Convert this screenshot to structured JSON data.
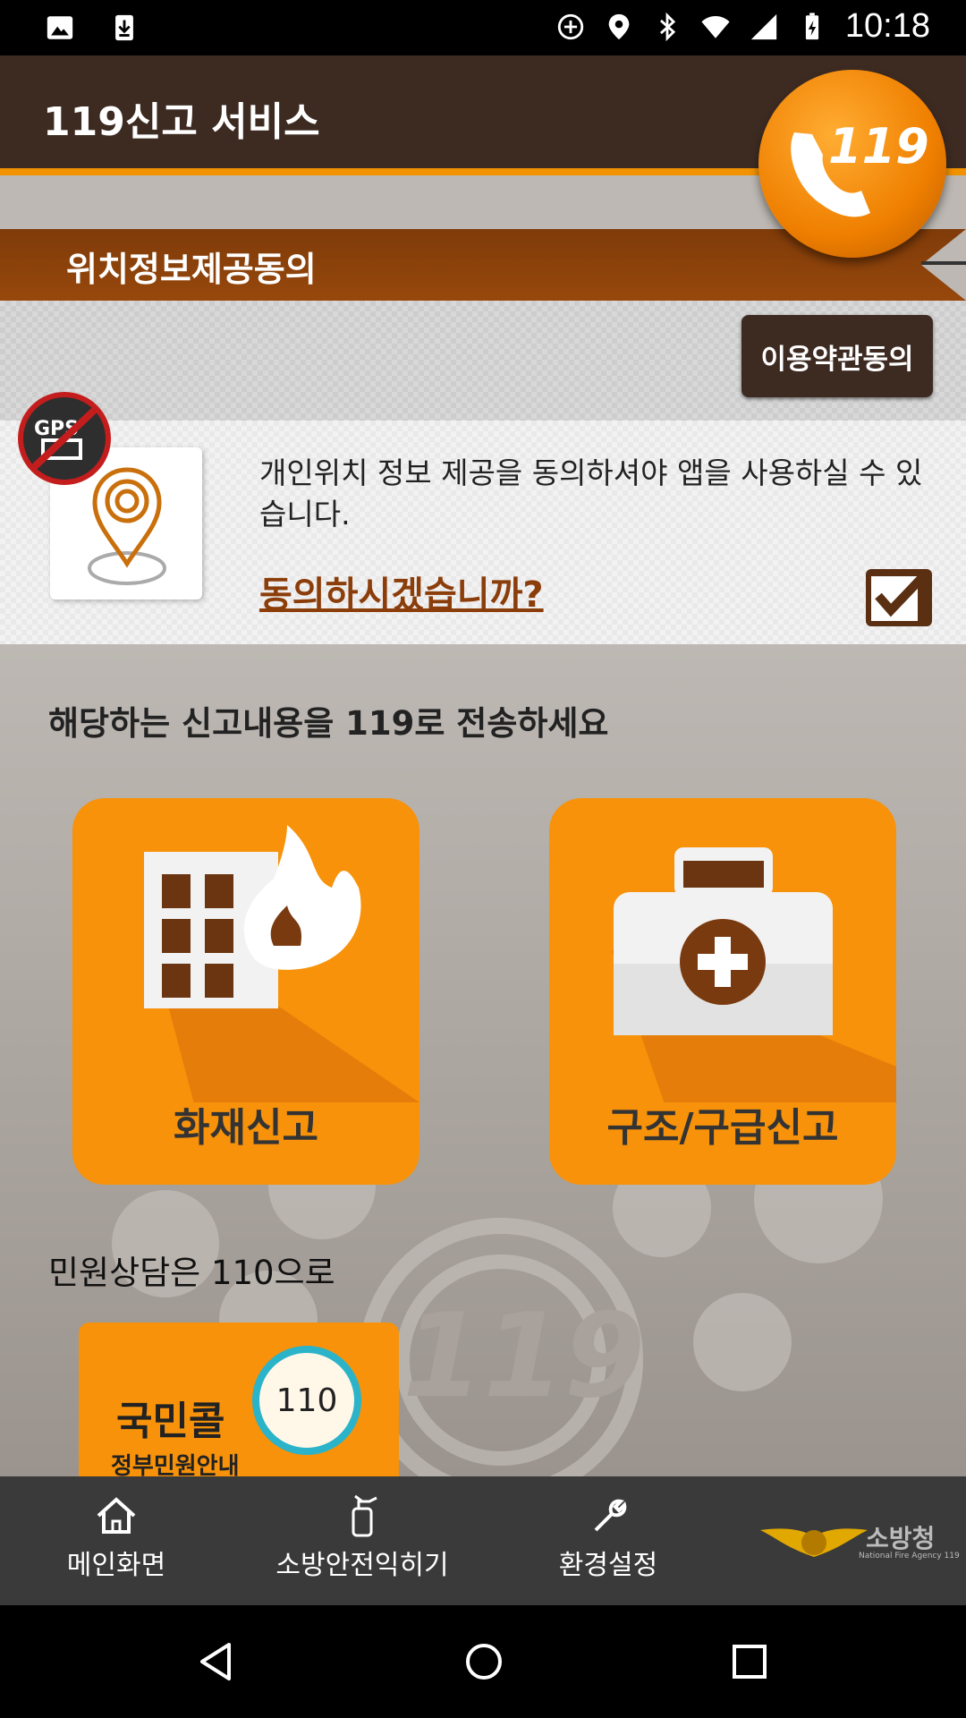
{
  "status_bar": {
    "time": "10:18",
    "left_icons": [
      "image-icon",
      "download-icon"
    ],
    "right_icons": [
      "sync-icon",
      "location-icon",
      "bluetooth-icon",
      "wifi-icon",
      "signal-icon",
      "battery-icon"
    ]
  },
  "app_bar": {
    "title": "119신고 서비스",
    "badge_text": "119"
  },
  "location_consent": {
    "banner_title": "위치정보제공동의",
    "terms_button": "이용약관동의",
    "gps_badge_text": "GPS",
    "message": "개인위치 정보 제공을 동의하셔야 앱을 사용하실 수 있습니다.",
    "question": "동의하시겠습니까?",
    "checked": true
  },
  "report_section": {
    "heading": "해당하는 신고내용을 119로 전송하세요",
    "tiles": [
      {
        "label": "화재신고",
        "icon": "fire-building-icon"
      },
      {
        "label": "구조/구급신고",
        "icon": "first-aid-kit-icon"
      }
    ]
  },
  "civil_section": {
    "heading": "민원상담은 110으로",
    "card_title": "국민콜",
    "card_number": "110",
    "card_subtitle": "정부민원안내"
  },
  "background_watermark": "119",
  "bottom_nav": [
    {
      "label": "메인화면",
      "icon": "home-icon"
    },
    {
      "label": "소방안전익히기",
      "icon": "fire-extinguisher-icon"
    },
    {
      "label": "환경설정",
      "icon": "wrench-icon"
    }
  ],
  "agency_logo": {
    "name": "소방청",
    "english": "National Fire Agency 119"
  },
  "colors": {
    "accent": "#f7920a",
    "dark_brown": "#3d2b22",
    "banner_brown": "#8b3d0a"
  }
}
